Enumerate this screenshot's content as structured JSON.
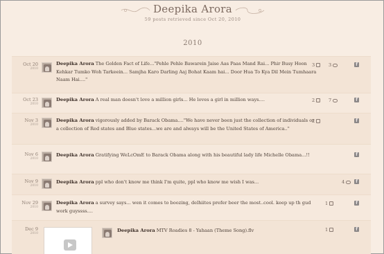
{
  "header": {
    "title": "Deepika Arora",
    "subtitle": "59 posts retrieved since Oct 20, 2010"
  },
  "year_label": "2010",
  "posts": [
    {
      "date": "Oct 20",
      "year": "2010",
      "name": "Deepika Arora",
      "text": "The Golden Fact of Life...\"Pehle Pehle Bawarein Jaise Aas Paas Mand Rai... Phir Busy Hoon Kehkar Tumko Woh Tarkeein... Samjha Karo Darling Aaj Bohat Kaam hai... Door Hua To Kya Dil Mein Tumhaara Naam Hai....\"",
      "likes": "3",
      "comments": "3"
    },
    {
      "date": "Oct 23",
      "year": "2010",
      "name": "Deepika Arora",
      "text": "A real man doesn't love a million girls... He loves a girl in million ways....",
      "likes": "2",
      "comments": "7"
    },
    {
      "date": "Nov 3",
      "year": "2010",
      "name": "Deepika Arora",
      "text": "vigorously added by Barack Obama....\"We have never been just the collection of individuals or a collection of Red states and Blue states...we are and always will be the United States of America..\"",
      "likes": "2",
      "comments": ""
    },
    {
      "date": "Nov 6",
      "year": "2010",
      "name": "Deepika Arora",
      "text": "Gratifying WeLcOmE to Barack Obama along with his beautiful lady life Michelle Obama...!!",
      "likes": "",
      "comments": ""
    },
    {
      "date": "Nov 9",
      "year": "2010",
      "name": "Deepika Arora",
      "text": "ppl who don't know me think I'm quite, ppl who know me wish I was...",
      "likes": "",
      "comments": "4"
    },
    {
      "date": "Nov 29",
      "year": "2010",
      "name": "Deepika Arora",
      "text": "a survey says... wen it comes to boozing, delhiites prefer beer the most..cool. keep up th gud work guyssss....",
      "likes": "1",
      "comments": ""
    },
    {
      "date": "Dec 9",
      "year": "2010",
      "name": "Deepika Arora",
      "text": "MTV Roadies 8 - Yahaan (Theme Song).flv",
      "likes": "1",
      "comments": ""
    }
  ],
  "icons": {
    "like": "thumb-up-icon",
    "comment": "speech-bubble-icon",
    "facebook": "facebook-icon",
    "facebook_glyph": "f"
  }
}
